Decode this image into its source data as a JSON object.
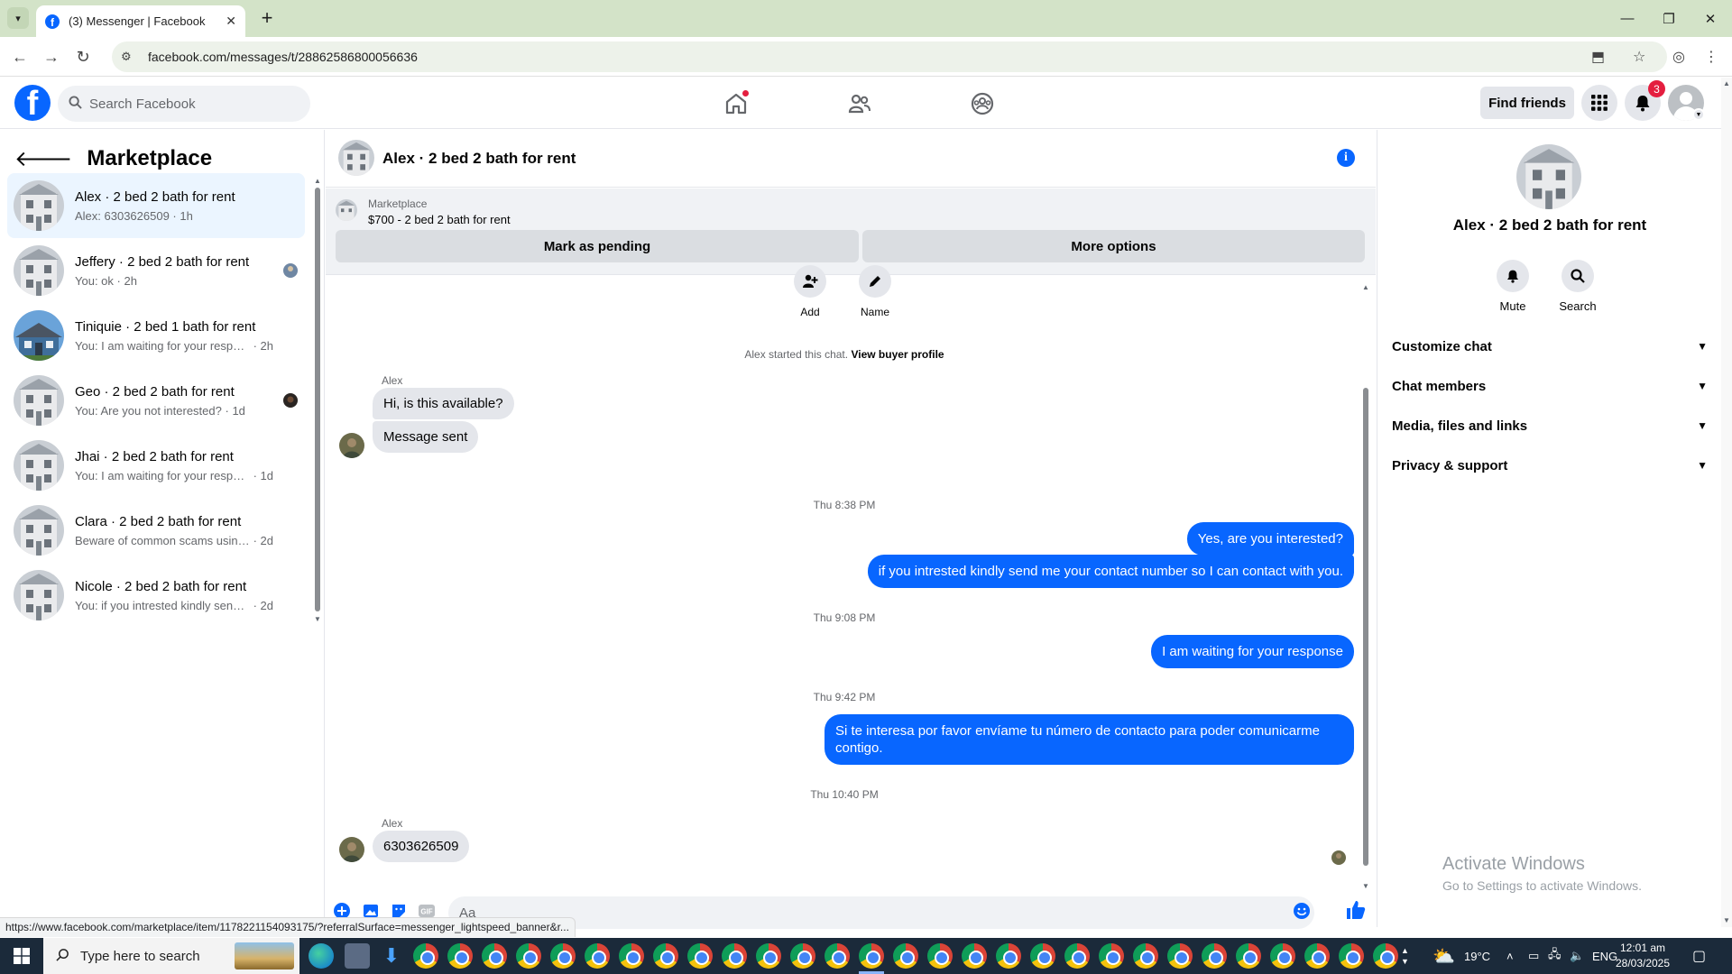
{
  "browser": {
    "tab_title": "(3) Messenger | Facebook",
    "url": "facebook.com/messages/t/28862586800056636",
    "status_url": "https://www.facebook.com/marketplace/item/1178221154093175/?referralSurface=messenger_lightspeed_banner&r..."
  },
  "header": {
    "search_placeholder": "Search Facebook",
    "find_friends": "Find friends",
    "notification_count": "3"
  },
  "sidebar": {
    "title": "Marketplace",
    "conversations": [
      {
        "name": "Alex · 2 bed 2 bath for rent",
        "snippet": "Alex: 6303626509",
        "time": "1h",
        "active": true
      },
      {
        "name": "Jeffery · 2 bed 2 bath for rent",
        "snippet": "You: ok",
        "time": "2h"
      },
      {
        "name": "Tiniquie · 2 bed 1 bath for rent",
        "snippet": "You: I am waiting for your response",
        "time": "2h"
      },
      {
        "name": "Geo · 2 bed 2 bath for rent",
        "snippet": "You: Are you not interested?",
        "time": "1d"
      },
      {
        "name": "Jhai · 2 bed 2 bath for rent",
        "snippet": "You: I am waiting for your response",
        "time": "1d"
      },
      {
        "name": "Clara · 2 bed 2 bath for rent",
        "snippet": "Beware of common scams using pa...",
        "time": "2d"
      },
      {
        "name": "Nicole · 2 bed 2 bath for rent",
        "snippet": "You: if you intrested kindly send m...",
        "time": "2d"
      }
    ]
  },
  "chat": {
    "title": "Alex · 2 bed 2 bath for rent",
    "banner": {
      "label": "Marketplace",
      "price": "$700 - 2 bed 2 bath for rent",
      "mark_pending": "Mark as pending",
      "more_options": "More options"
    },
    "actions": {
      "add": "Add",
      "name": "Name"
    },
    "system": {
      "started": "Alex started this chat.",
      "link": "View buyer profile"
    },
    "sender": "Alex",
    "messages_in_1": [
      "Hi, is this available?",
      "Message sent"
    ],
    "timestamps": [
      "Thu 8:38 PM",
      "Thu 9:08 PM",
      "Thu 9:42 PM",
      "Thu 10:40 PM"
    ],
    "out_1": [
      "Yes, are you interested?",
      "if you intrested kindly send me your contact number so I can contact with you."
    ],
    "out_2": "I am waiting for your response",
    "out_3": "Si te interesa por favor envíame tu número de contacto para poder comunicarme contigo.",
    "in_last": "6303626509",
    "composer_placeholder": "Aa"
  },
  "right_panel": {
    "name": "Alex · 2 bed 2 bath for rent",
    "mute": "Mute",
    "search": "Search",
    "sections": [
      "Customize chat",
      "Chat members",
      "Media, files and links",
      "Privacy & support"
    ]
  },
  "watermark": {
    "line1": "Activate Windows",
    "line2": "Go to Settings to activate Windows."
  },
  "taskbar": {
    "search_placeholder": "Type here to search",
    "temperature": "19°C",
    "language": "ENG",
    "time": "12:01 am",
    "date": "28/03/2025"
  }
}
